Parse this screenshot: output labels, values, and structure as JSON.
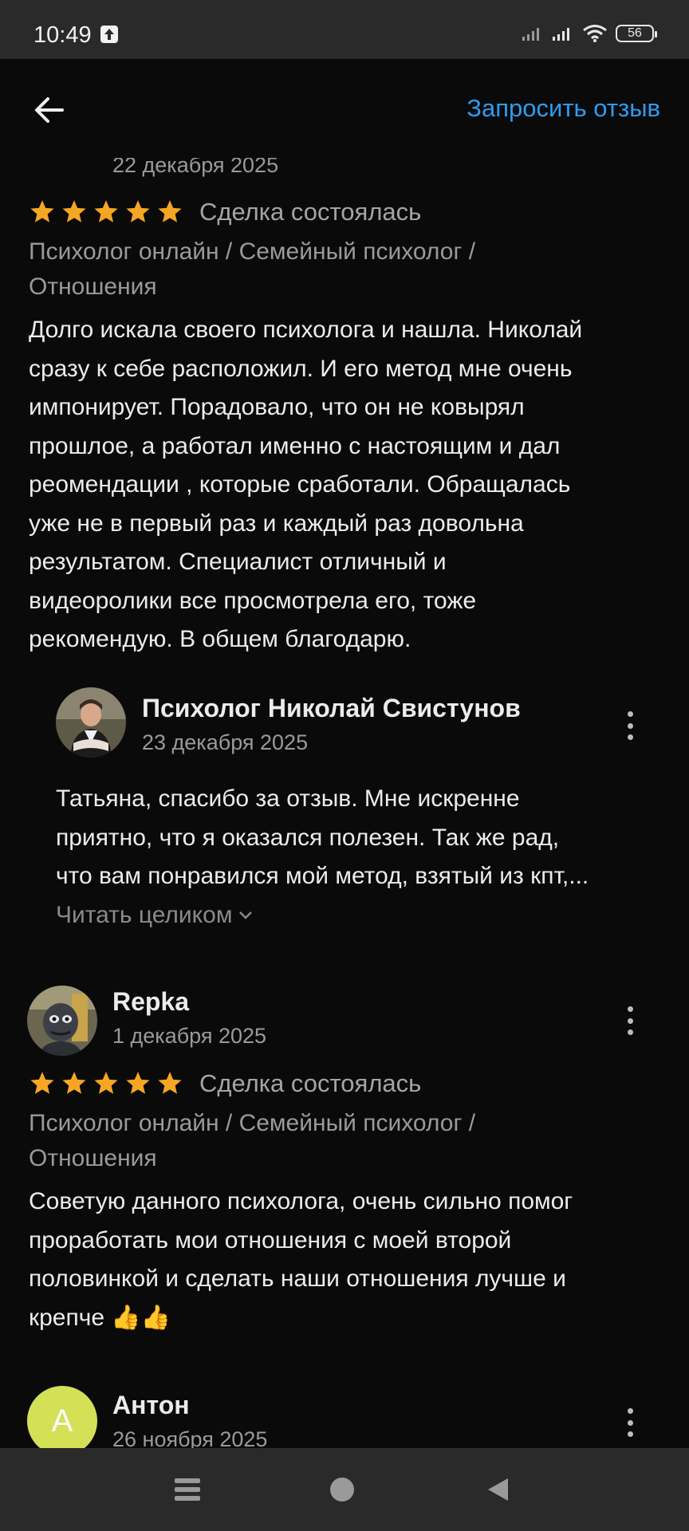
{
  "status_bar": {
    "time": "10:49",
    "battery": "56"
  },
  "app_bar": {
    "request_review": "Запросить отзыв"
  },
  "review1": {
    "date": "22 декабря 2025",
    "rating": 5,
    "status": "Сделка состоялась",
    "category_line1": "Психолог онлайн / Семейный психолог /",
    "category_line2": "Отношения",
    "text_lines": [
      "Долго искала своего психолога и нашла. Николай",
      "сразу к себе расположил. И его метод мне очень",
      "импонирует. Порадовало, что он не ковырял",
      "прошлое, а работал именно с настоящим и дал",
      "реомендации , которые сработали. Обращалась",
      "уже не в первый раз и каждый раз довольна",
      "результатом. Специалист отличный и",
      "видеоролики все просмотрела его, тоже",
      "рекомендую. В общем благодарю."
    ],
    "reply": {
      "author": "Психолог Николай Свистунов",
      "date": "23 декабря 2025",
      "text_lines": [
        "Татьяна, спасибо за отзыв. Мне искренне",
        "приятно, что я оказался полезен. Так же  рад,",
        "что вам  понравился мой метод, взятый из кпт,..."
      ],
      "read_more": "Читать целиком"
    }
  },
  "review2": {
    "author": "Repka",
    "date": "1 декабря 2025",
    "rating": 5,
    "status": "Сделка состоялась",
    "category_line1": "Психолог онлайн / Семейный психолог /",
    "category_line2": "Отношения",
    "text_lines": [
      "Советую данного психолога, очень сильно помог",
      "проработать мои отношения с моей второй",
      "половинкой и сделать наши отношения лучше и",
      "крепче 👍👍"
    ]
  },
  "review3": {
    "author": "Антон",
    "avatar_letter": "А",
    "date": "26 ноября 2025"
  },
  "colors": {
    "accent": "#2f9bf0",
    "star": "#f5a623",
    "avatar_letter_bg": "#d4e157"
  }
}
